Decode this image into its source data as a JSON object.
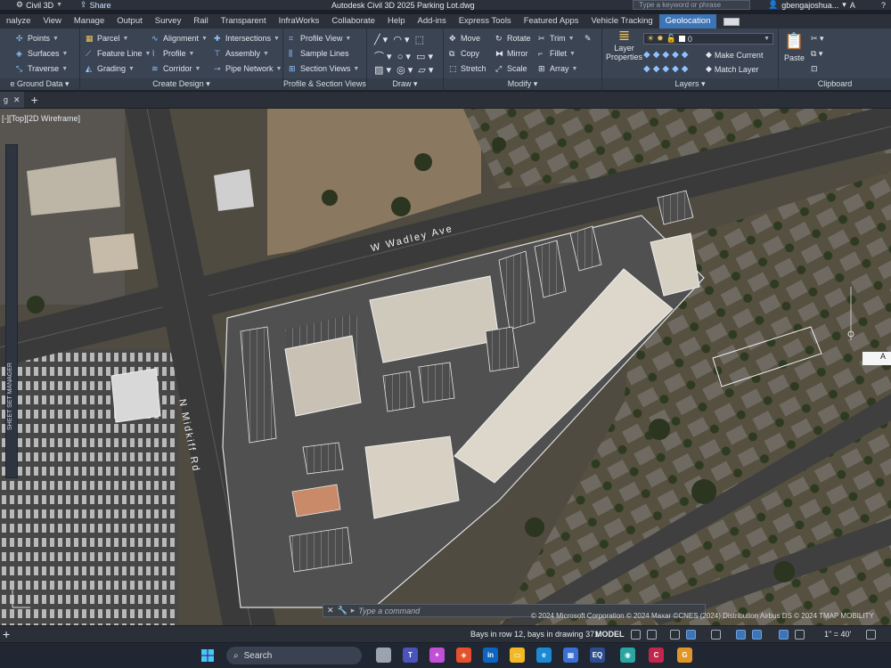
{
  "titlebar": {
    "workspace": "Civil 3D",
    "share": "Share",
    "app_title": "Autodesk Civil 3D 2025   Parking Lot.dwg",
    "search_placeholder": "Type a keyword or phrase",
    "user": "gbengajoshua..."
  },
  "tabs": [
    "nalyze",
    "View",
    "Manage",
    "Output",
    "Survey",
    "Rail",
    "Transparent",
    "InfraWorks",
    "Collaborate",
    "Help",
    "Add-ins",
    "Express Tools",
    "Featured Apps",
    "Vehicle Tracking",
    "Geolocation"
  ],
  "active_tab": "Geolocation",
  "ribbon": {
    "ground_data": {
      "title": "e Ground Data",
      "points": "Points",
      "surfaces": "Surfaces",
      "traverse": "Traverse"
    },
    "create_design": {
      "title": "Create Design",
      "parcel": "Parcel",
      "feature_line": "Feature Line",
      "grading": "Grading",
      "alignment": "Alignment",
      "profile": "Profile",
      "corridor": "Corridor",
      "intersections": "Intersections",
      "assembly": "Assembly",
      "pipe_network": "Pipe Network"
    },
    "profile_section": {
      "title": "Profile & Section Views",
      "profile_view": "Profile View",
      "sample_lines": "Sample Lines",
      "section_views": "Section Views"
    },
    "draw": {
      "title": "Draw"
    },
    "modify": {
      "title": "Modify",
      "move": "Move",
      "rotate": "Rotate",
      "trim": "Trim",
      "copy": "Copy",
      "mirror": "Mirror",
      "fillet": "Fillet",
      "stretch": "Stretch",
      "scale": "Scale",
      "array": "Array"
    },
    "layers": {
      "title": "Layers",
      "layer_properties": "Layer\nProperties",
      "layer_value": "0",
      "make_current": "Make Current",
      "match_layer": "Match Layer"
    },
    "clipboard": {
      "title": "Clipboard",
      "paste": "Paste"
    }
  },
  "doctab": {
    "name": "g"
  },
  "canvas": {
    "view_label": "[-][Top][2D Wireframe]",
    "street_1": "W Wadley Ave",
    "street_2": "N Midkiff Rd",
    "sheet_set": "SHEET SET MANAGER",
    "command_placeholder": "Type a command",
    "copyright": "© 2024 Microsoft Corporation © 2024 Maxar ©CNES (2024) Distribution Airbus DS © 2024 TMAP MOBILITY",
    "label_a": "A"
  },
  "statusbar": {
    "message": "Bays in row 12, bays in drawing 371",
    "model": "MODEL",
    "scale": "1\" = 40'"
  },
  "taskbar": {
    "search": "Search"
  },
  "colors": {
    "accent": "#3d74b5",
    "ribbon_bg": "#3b4453",
    "canvas_bg": "#3b3a36"
  }
}
